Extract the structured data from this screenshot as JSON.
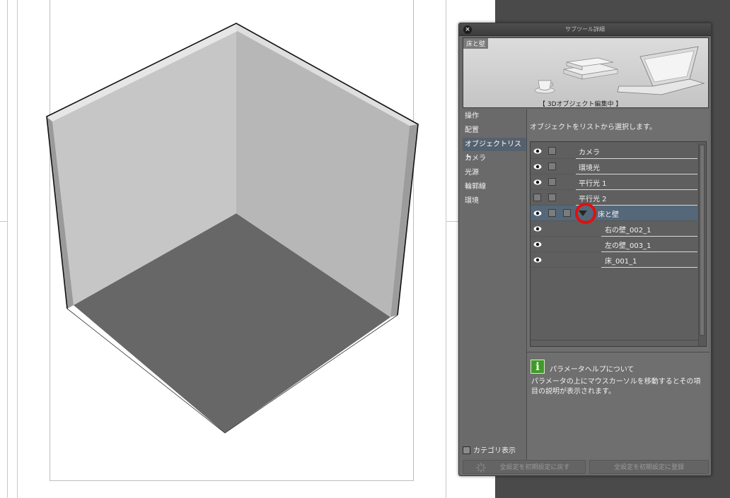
{
  "panel": {
    "title": "サブツール詳細",
    "close_label": "×",
    "preview": {
      "name": "床と壁",
      "caption": "【 3Dオブジェクト編集中 】"
    },
    "categories": [
      {
        "label": "操作",
        "selected": false
      },
      {
        "label": "配置",
        "selected": false
      },
      {
        "label": "オブジェクトリスト",
        "selected": true
      },
      {
        "label": "カメラ",
        "selected": false
      },
      {
        "label": "光源",
        "selected": false
      },
      {
        "label": "輪郭線",
        "selected": false
      },
      {
        "label": "環境",
        "selected": false
      }
    ],
    "category_toggle_label": "カテゴリ表示",
    "description": "オブジェクトをリストから選択します。",
    "object_list": [
      {
        "label": "カメラ",
        "visible": true
      },
      {
        "label": "環境光",
        "visible": true
      },
      {
        "label": "平行光 1",
        "visible": true
      },
      {
        "label": "平行光 2",
        "visible": false
      },
      {
        "label": "床と壁",
        "visible": true,
        "selected": true
      },
      {
        "label": "右の壁_002_1",
        "visible": true
      },
      {
        "label": "左の壁_003_1",
        "visible": true
      },
      {
        "label": "床_001_1",
        "visible": true
      }
    ],
    "help": {
      "icon": "info-icon",
      "icon_glyph": "i",
      "title": "パラメータヘルプについて",
      "body": "パラメータの上にマウスカーソルを移動するとその項目の説明が表示されます。"
    },
    "footer": {
      "reset_label": "全設定を初期設定に戻す",
      "register_label": "全設定を初期設定に登録"
    }
  },
  "colors": {
    "panel_bg": "#6b6b6b",
    "selection": "#54687a",
    "highlight_marker": "#e01010",
    "help_icon": "#3f9a28"
  }
}
